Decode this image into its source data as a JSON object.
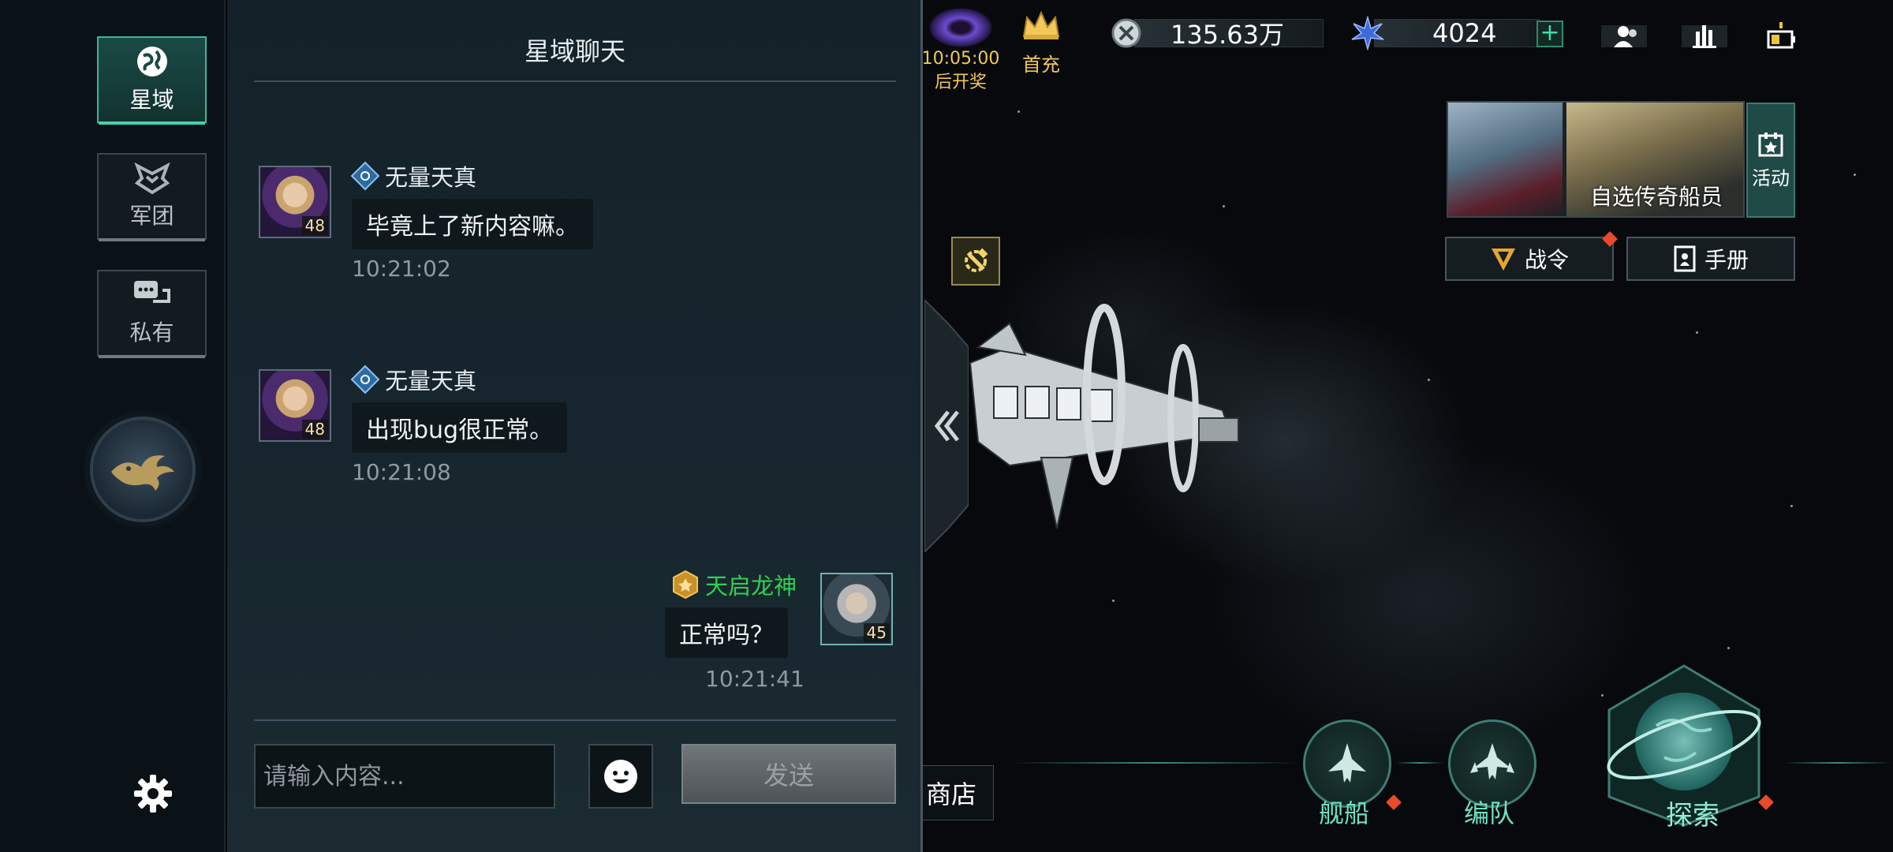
{
  "rail": {
    "tabs": [
      {
        "label": "星域",
        "icon": "globe-icon",
        "active": true
      },
      {
        "label": "军团",
        "icon": "legion-emblem-icon",
        "active": false
      },
      {
        "label": "私有",
        "icon": "chat-bubbles-icon",
        "active": false
      }
    ]
  },
  "chat": {
    "title": "星域聊天",
    "messages": [
      {
        "name": "无量天真",
        "text": "毕竟上了新内容嘛。",
        "time": "10:21:02",
        "level": "48",
        "side": "left"
      },
      {
        "name": "无量天真",
        "text": "出现bug很正常。",
        "time": "10:21:08",
        "level": "48",
        "side": "left"
      },
      {
        "name": "天启龙神",
        "text": "正常吗？",
        "time": "10:21:41",
        "level": "45",
        "side": "right",
        "name_color": "#2fd14f"
      }
    ],
    "input_placeholder": "请输入内容...",
    "send_label": "发送"
  },
  "hud": {
    "lottery_timer": "10:05:00",
    "lottery_label": "后开奖",
    "first_charge": "首充",
    "currency1": "135.63万",
    "currency2": "4024",
    "plus": "+"
  },
  "banner": {
    "label": "自选传奇船员",
    "activity": "活动"
  },
  "side_buttons": {
    "battle_pass": "战令",
    "manual": "手册"
  },
  "bottom": {
    "shop": "商店",
    "ships": "舰船",
    "fleet": "编队",
    "explore": "探索"
  },
  "colors": {
    "accent": "#3fd3b2",
    "gold": "#f2c85b",
    "green_name": "#2fd14f",
    "alert": "#e84a2b"
  }
}
